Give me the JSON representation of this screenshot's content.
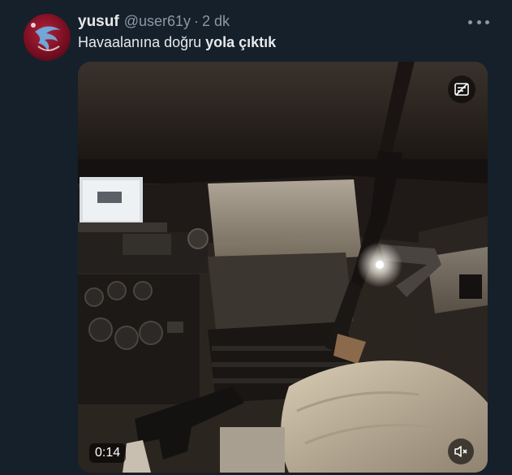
{
  "tweet": {
    "display_name": "yusuf",
    "handle": "@user61y",
    "separator": "·",
    "time": "2 dk",
    "text_plain": "Havaalanına doğru ",
    "text_bold": "yola çıktık",
    "more_icon": "more-horizontal-icon"
  },
  "media": {
    "duration": "0:14",
    "settings_icon": "media-settings-icon",
    "mute_icon": "muted-speaker-icon"
  },
  "colors": {
    "background": "#15202b",
    "primary_text": "#e7e9ea",
    "secondary_text": "#8b98a5"
  }
}
